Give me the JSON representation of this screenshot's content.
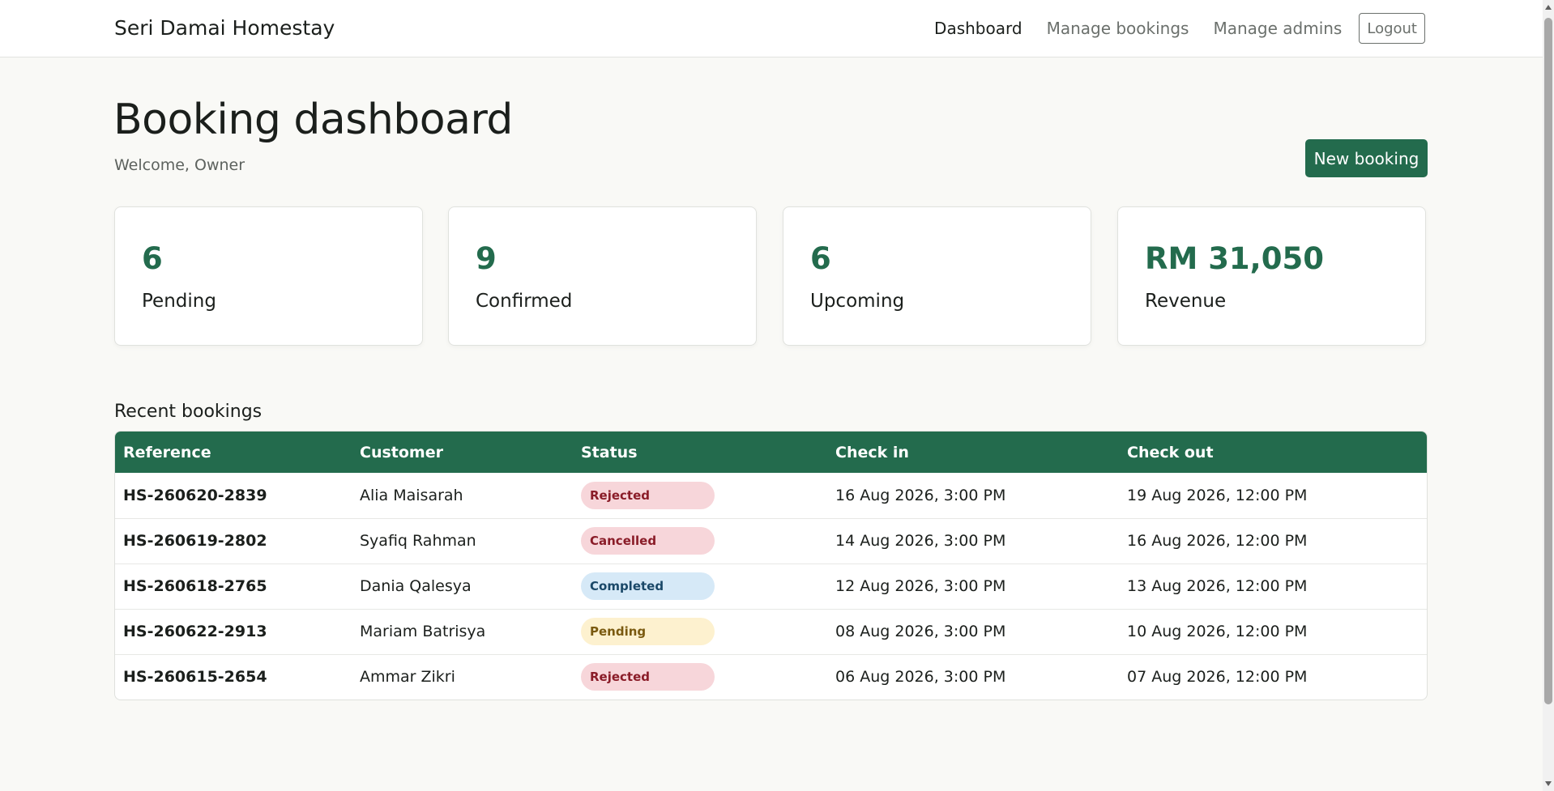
{
  "nav": {
    "brand": "Seri Damai Homestay",
    "links": [
      "Dashboard",
      "Manage bookings",
      "Manage admins"
    ],
    "logout": "Logout"
  },
  "header": {
    "title": "Booking dashboard",
    "welcome": "Welcome, Owner",
    "new_booking": "New booking"
  },
  "stats": [
    {
      "value": "6",
      "label": "Pending"
    },
    {
      "value": "9",
      "label": "Confirmed"
    },
    {
      "value": "6",
      "label": "Upcoming"
    },
    {
      "value": "RM 31,050",
      "label": "Revenue"
    }
  ],
  "recent": {
    "title": "Recent bookings",
    "columns": [
      "Reference",
      "Customer",
      "Status",
      "Check in",
      "Check out"
    ],
    "rows": [
      {
        "ref": "HS-260620-2839",
        "customer": "Alia Maisarah",
        "status": "Rejected",
        "check_in": "16 Aug 2026, 3:00 PM",
        "check_out": "19 Aug 2026, 12:00 PM"
      },
      {
        "ref": "HS-260619-2802",
        "customer": "Syafiq Rahman",
        "status": "Cancelled",
        "check_in": "14 Aug 2026, 3:00 PM",
        "check_out": "16 Aug 2026, 12:00 PM"
      },
      {
        "ref": "HS-260618-2765",
        "customer": "Dania Qalesya",
        "status": "Completed",
        "check_in": "12 Aug 2026, 3:00 PM",
        "check_out": "13 Aug 2026, 12:00 PM"
      },
      {
        "ref": "HS-260622-2913",
        "customer": "Mariam Batrisya",
        "status": "Pending",
        "check_in": "08 Aug 2026, 3:00 PM",
        "check_out": "10 Aug 2026, 12:00 PM"
      },
      {
        "ref": "HS-260615-2654",
        "customer": "Ammar Zikri",
        "status": "Rejected",
        "check_in": "06 Aug 2026, 3:00 PM",
        "check_out": "07 Aug 2026, 12:00 PM"
      }
    ]
  },
  "colors": {
    "accent": "#236b4d",
    "rejected_bg": "#f7d6da",
    "completed_bg": "#d6e9f7",
    "pending_bg": "#fdf1cf"
  }
}
